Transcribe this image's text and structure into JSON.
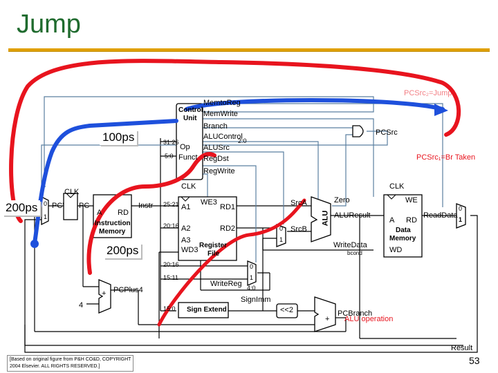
{
  "slide": {
    "title": "Jump",
    "page_number": "53",
    "credit_line1": "[Based on original figure from P&H CO&D, COPYRIGHT",
    "credit_line2": "2004 Elsevier. ALL RIGHTS RESERVED.]"
  },
  "timing_tags": {
    "tag1": "100ps",
    "tag2": "200ps",
    "tag3": "200ps"
  },
  "annotations": {
    "pcsrc_jump": "PCSrc₂=Jump",
    "pcsrc_br": "PCSrc₁=Br Taken",
    "bcond": "bcond",
    "alu_op": "ALU operation"
  },
  "control_unit": {
    "title_line1": "Control",
    "title_line2": "Unit",
    "op": "Op",
    "funct": "Funct",
    "outputs": [
      "MemtoReg",
      "MemWrite",
      "Branch",
      "ALUControl",
      "ALUSrc",
      "RegDst",
      "RegWrite"
    ],
    "alucontrol_sub": "2:0"
  },
  "datapath": {
    "pcsrc": "PCSrc",
    "clk": "CLK",
    "pc_prime": "PC'",
    "pc": "PC",
    "mux0": "0",
    "mux1": "1",
    "imem_a": "A",
    "imem_rd": "RD",
    "imem_name1": "Instruction",
    "imem_name2": "Memory",
    "instr": "Instr",
    "bits_31_26": "31:26",
    "bits_5_0": "5:0",
    "bits_25_21": "25:21",
    "bits_20_16a": "20:16",
    "bits_20_16b": "20:16",
    "bits_15_11": "15:11",
    "bits_15_0": "15:0",
    "rf_we3": "WE3",
    "rf_a1": "A1",
    "rf_a2": "A2",
    "rf_a3": "A3",
    "rf_wd3": "WD3",
    "rf_rd1": "RD1",
    "rf_rd2": "RD2",
    "rf_name1": "Register",
    "rf_name2": "File",
    "srca": "SrcA",
    "srcb": "SrcB",
    "writedata": "WriteData",
    "writereg": "WriteReg",
    "writereg_sub": "4:0",
    "zero": "Zero",
    "alu": "ALU",
    "aluresult": "ALUResult",
    "dm_we": "WE",
    "dm_a": "A",
    "dm_rd": "RD",
    "dm_wd": "WD",
    "dm_name1": "Data",
    "dm_name2": "Memory",
    "readdata": "ReadData",
    "pcplus4": "PCPlus4",
    "four": "4",
    "plus": "+",
    "sign_extend": "Sign Extend",
    "signimm": "SignImm",
    "shift2": "<<2",
    "pcbranch": "PCBranch",
    "result": "Result"
  },
  "colors": {
    "title": "#1f6b2e",
    "rule": "#e0a000",
    "wire": "#000000",
    "control_wire": "#5a7fa0",
    "red_path": "#e8141e",
    "blue_path": "#1e50dc",
    "ann_red": "#e8141e"
  }
}
